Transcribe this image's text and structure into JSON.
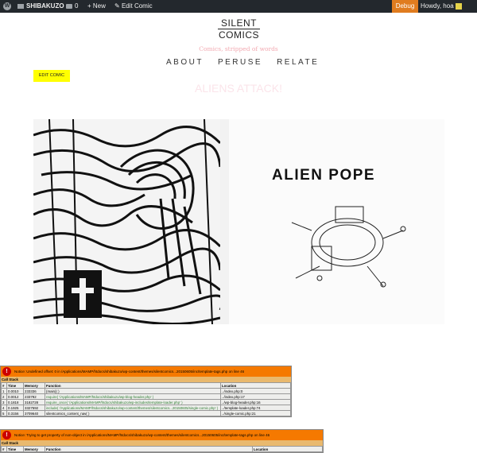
{
  "adminbar": {
    "site_name": "SHIBAKUZO",
    "comments_count": "0",
    "new_label": "New",
    "edit_comic_label": "Edit Comic",
    "debug_label": "Debug",
    "howdy_label": "Howdy, hoa"
  },
  "site": {
    "logo_line1": "SILENT",
    "logo_line2": "COMICS",
    "tagline": "Comics, stripped of words",
    "nav": [
      "ABOUT",
      "PERUSE",
      "RELATE"
    ]
  },
  "post": {
    "edit_button": "EDIT COMIC",
    "title": "ALIENS ATTACK!",
    "comic_caption": "ALIEN POPE"
  },
  "notices": [
    {
      "icon": "!",
      "message": "Notice: Undefined offset: 0 in /Applications/MAMP/htdocs/shibakuzo/wp-content/themes/silentcomics...20150605/inc/template-tags.php on line 46",
      "call_stack_label": "Call Stack",
      "columns": [
        "#",
        "Time",
        "Memory",
        "Function",
        "Location"
      ],
      "rows": [
        [
          "1",
          "0.0010",
          "233336",
          "{main}( )",
          "../index.php:0"
        ],
        [
          "2",
          "0.0012",
          "233792",
          "require( '/Applications/MAMP/htdocs/shibakuzo/wp-blog-header.php' )",
          "../index.php:17"
        ],
        [
          "3",
          "0.1818",
          "3182728",
          "require_once( '/Applications/MAMP/htdocs/shibakuzo/wp-includes/template-loader.php' )",
          "../wp-blog-header.php:16"
        ],
        [
          "4",
          "0.1925",
          "3327592",
          "include( '/Applications/MAMP/htdocs/shibakuzo/wp-content/themes/silentcomics...20150605/single-comic.php' )",
          "../template-loader.php:74"
        ],
        [
          "5",
          "0.3156",
          "3709640",
          "silentcomics_content_nav( )",
          "../single-comic.php:21"
        ]
      ]
    },
    {
      "icon": "!",
      "message": "Notice: Trying to get property of non-object in /Applications/MAMP/htdocs/shibakuzo/wp-content/themes/silentcomics...20150605/inc/template-tags.php on line 46",
      "call_stack_label": "Call Stack",
      "columns": [
        "#",
        "Time",
        "Memory",
        "Function",
        "Location"
      ],
      "rows": []
    }
  ],
  "colors": {
    "adminbar_bg": "#23282d",
    "debug_bg": "#e07c1f",
    "tagline": "#f2a9b1",
    "edit_button_bg": "#ffff00",
    "notice_header": "#f57900",
    "notice_callstack": "#e9b96e"
  }
}
